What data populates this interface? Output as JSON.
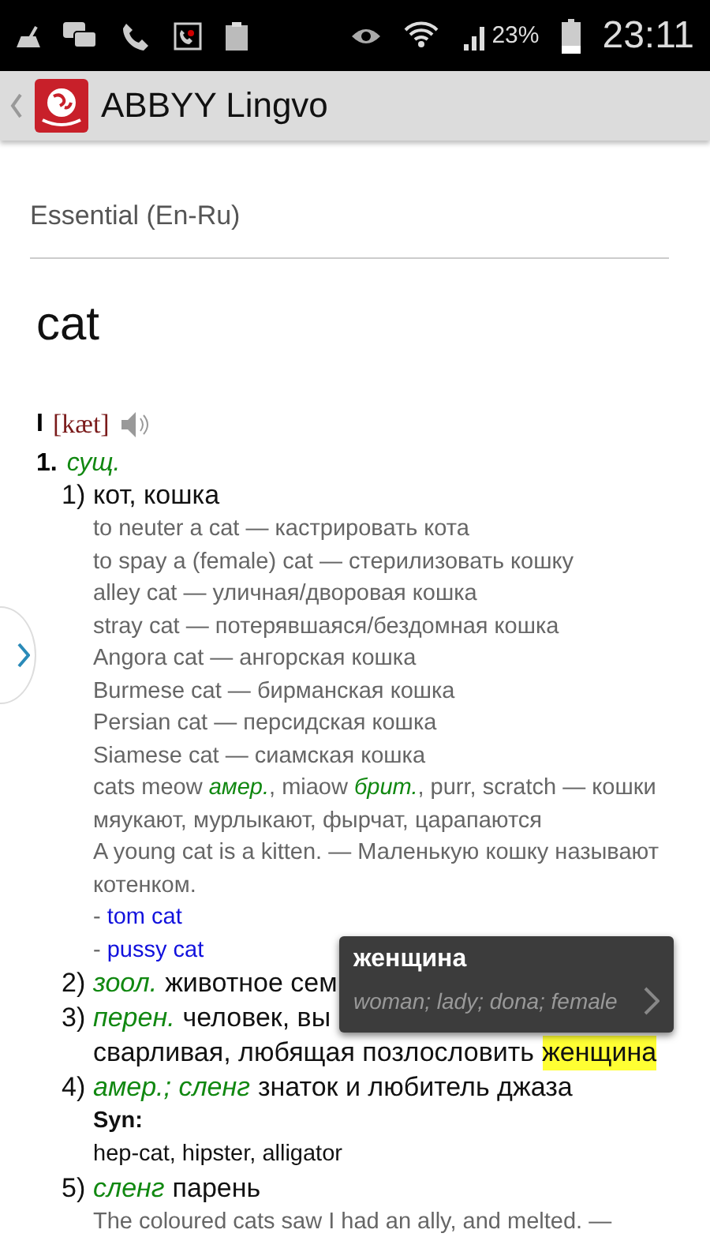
{
  "status_bar": {
    "battery": "23%",
    "time": "23:11"
  },
  "app_bar": {
    "title": "ABBYY Lingvo"
  },
  "dictionary": "Essential (En-Ru)",
  "headword": "cat",
  "entry": {
    "roman": "I",
    "transcription": "[kæt]",
    "pos_number": "1.",
    "pos": "сущ.",
    "senses": [
      {
        "number": "1)",
        "lines": [
          [
            {
              "kind": "text",
              "text": "кот, кошка"
            }
          ]
        ],
        "examples": [
          "to neuter a cat — кастрировать кота",
          "to spay a (female) cat — стерилизовать кошку",
          "alley cat — уличная/дворовая кошка",
          "stray cat — потерявшаяся/бездомная кошка",
          "Angora cat — ангорская кошка",
          "Burmese cat — бирманская кошка",
          "Persian cat — персидская кошка",
          "Siamese cat — сиамская кошка",
          "cats meow *амер.*, miaow *брит.*, purr, scratch — кошки мяукают, мурлыкают, фырчат, царапаются",
          "A young cat is a kitten. — Маленькую кошку называют котенком."
        ],
        "links": [
          {
            "prefix": "-",
            "text": "tom cat"
          },
          {
            "prefix": "-",
            "text": "pussy cat"
          }
        ]
      },
      {
        "number": "2)",
        "lines": [
          [
            {
              "kind": "label",
              "text": "зоол."
            },
            {
              "kind": "text",
              "text": "животное сем"
            }
          ]
        ]
      },
      {
        "number": "3)",
        "lines": [
          [
            {
              "kind": "label",
              "text": "перен."
            },
            {
              "kind": "text",
              "text": "человек, вы"
            }
          ],
          [
            {
              "kind": "text",
              "text": "сварливая, любящая позлословить"
            },
            {
              "kind": "highlight",
              "text": "женщина"
            }
          ]
        ]
      },
      {
        "number": "4)",
        "lines": [
          [
            {
              "kind": "label",
              "text": "амер.; сленг"
            },
            {
              "kind": "text",
              "text": "знаток и любитель джаза"
            }
          ]
        ],
        "syn": {
          "label": "Syn:",
          "words": "hep-cat, hipster, alligator"
        }
      },
      {
        "number": "5)",
        "lines": [
          [
            {
              "kind": "label",
              "text": "сленг"
            },
            {
              "kind": "text",
              "text": "парень"
            }
          ]
        ],
        "examples": [
          "The coloured cats saw I had an ally, and melted. —"
        ]
      }
    ]
  },
  "popup": {
    "title": "женщина",
    "translations": "woman; lady; dona; female"
  }
}
